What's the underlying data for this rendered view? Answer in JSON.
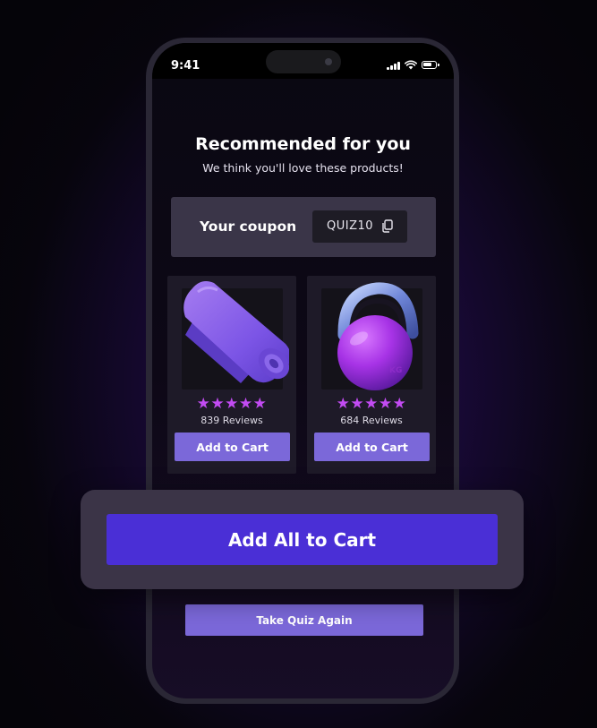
{
  "status_bar": {
    "time": "9:41"
  },
  "page": {
    "title": "Recommended for you",
    "subtitle": "We think you'll love these products!"
  },
  "coupon": {
    "label": "Your coupon",
    "code": "QUIZ10",
    "icon": "copy-icon"
  },
  "products": [
    {
      "image": "yoga-mat",
      "rating": 5,
      "stars": "★★★★★",
      "reviews": "839 Reviews",
      "button": "Add to Cart"
    },
    {
      "image": "kettlebell",
      "rating": 5,
      "stars": "★★★★★",
      "reviews": "684 Reviews",
      "button": "Add to Cart"
    }
  ],
  "actions": {
    "add_all": "Add All to Cart",
    "take_quiz": "Take Quiz Again"
  },
  "colors": {
    "accent": "#7b68d9",
    "primary": "#4a2fd6",
    "star": "#c24bf2",
    "panel": "#3b3447"
  }
}
